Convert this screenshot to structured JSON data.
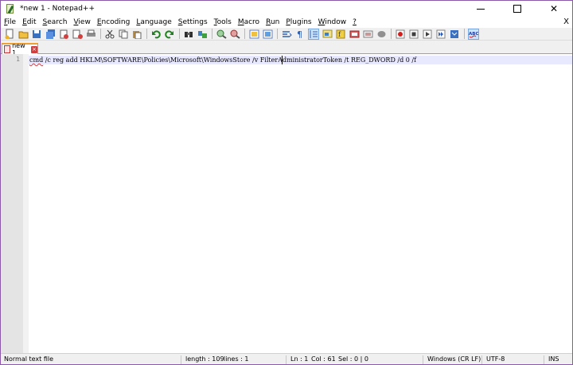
{
  "window": {
    "title": "*new 1 - Notepad++"
  },
  "window_controls": {
    "minimize": "—",
    "maximize": "□",
    "close": "✕"
  },
  "menubar": {
    "items": [
      {
        "label": "File",
        "u": "F",
        "rest": "ile"
      },
      {
        "label": "Edit",
        "u": "E",
        "rest": "dit"
      },
      {
        "label": "Search",
        "u": "S",
        "rest": "earch"
      },
      {
        "label": "View",
        "u": "V",
        "rest": "iew"
      },
      {
        "label": "Encoding",
        "u": "E",
        "rest": "ncoding"
      },
      {
        "label": "Language",
        "u": "L",
        "rest": "anguage"
      },
      {
        "label": "Settings",
        "u": "S",
        "rest": "ettings"
      },
      {
        "label": "Tools",
        "u": "T",
        "rest": "ools"
      },
      {
        "label": "Macro",
        "u": "M",
        "rest": "acro"
      },
      {
        "label": "Run",
        "u": "R",
        "rest": "un"
      },
      {
        "label": "Plugins",
        "u": "P",
        "rest": "lugins"
      },
      {
        "label": "Window",
        "u": "W",
        "rest": "indow"
      },
      {
        "label": "?",
        "u": "?",
        "rest": ""
      }
    ],
    "close": "X"
  },
  "tabs": [
    {
      "label": "new 1",
      "close": "×"
    }
  ],
  "editor": {
    "line_number": "1",
    "squiggle_word": "cmd",
    "line_rest": " /c reg add HKLM\\SOFTWARE\\Policies\\Microsoft\\WindowsStore /v FilterAdministratorToken /t REG_DWORD /d 0 /f"
  },
  "statusbar": {
    "file_type": "Normal text file",
    "length": "length : 109",
    "lines": "lines : 1",
    "ln": "Ln : 1",
    "col": "Col : 61",
    "sel": "Sel : 0 | 0",
    "eol": "Windows (CR LF)",
    "encoding": "UTF-8",
    "mode": "INS"
  },
  "toolbar_icons": [
    "new-file-icon",
    "open-file-icon",
    "save-icon",
    "save-all-icon",
    "close-icon",
    "close-all-icon",
    "print-icon",
    "cut-icon",
    "copy-icon",
    "paste-icon",
    "undo-icon",
    "redo-icon",
    "find-icon",
    "replace-icon",
    "zoom-in-icon",
    "zoom-out-icon",
    "sync-vertical-icon",
    "sync-horizontal-icon",
    "word-wrap-icon",
    "show-all-chars-icon",
    "indent-guide-icon",
    "document-map-icon",
    "function-list-icon",
    "folder-workspace-icon",
    "monitoring-icon",
    "record-macro-icon",
    "stop-record-icon",
    "play-macro-icon",
    "run-macro-multiple-icon",
    "save-macro-icon",
    "spell-check-icon"
  ]
}
